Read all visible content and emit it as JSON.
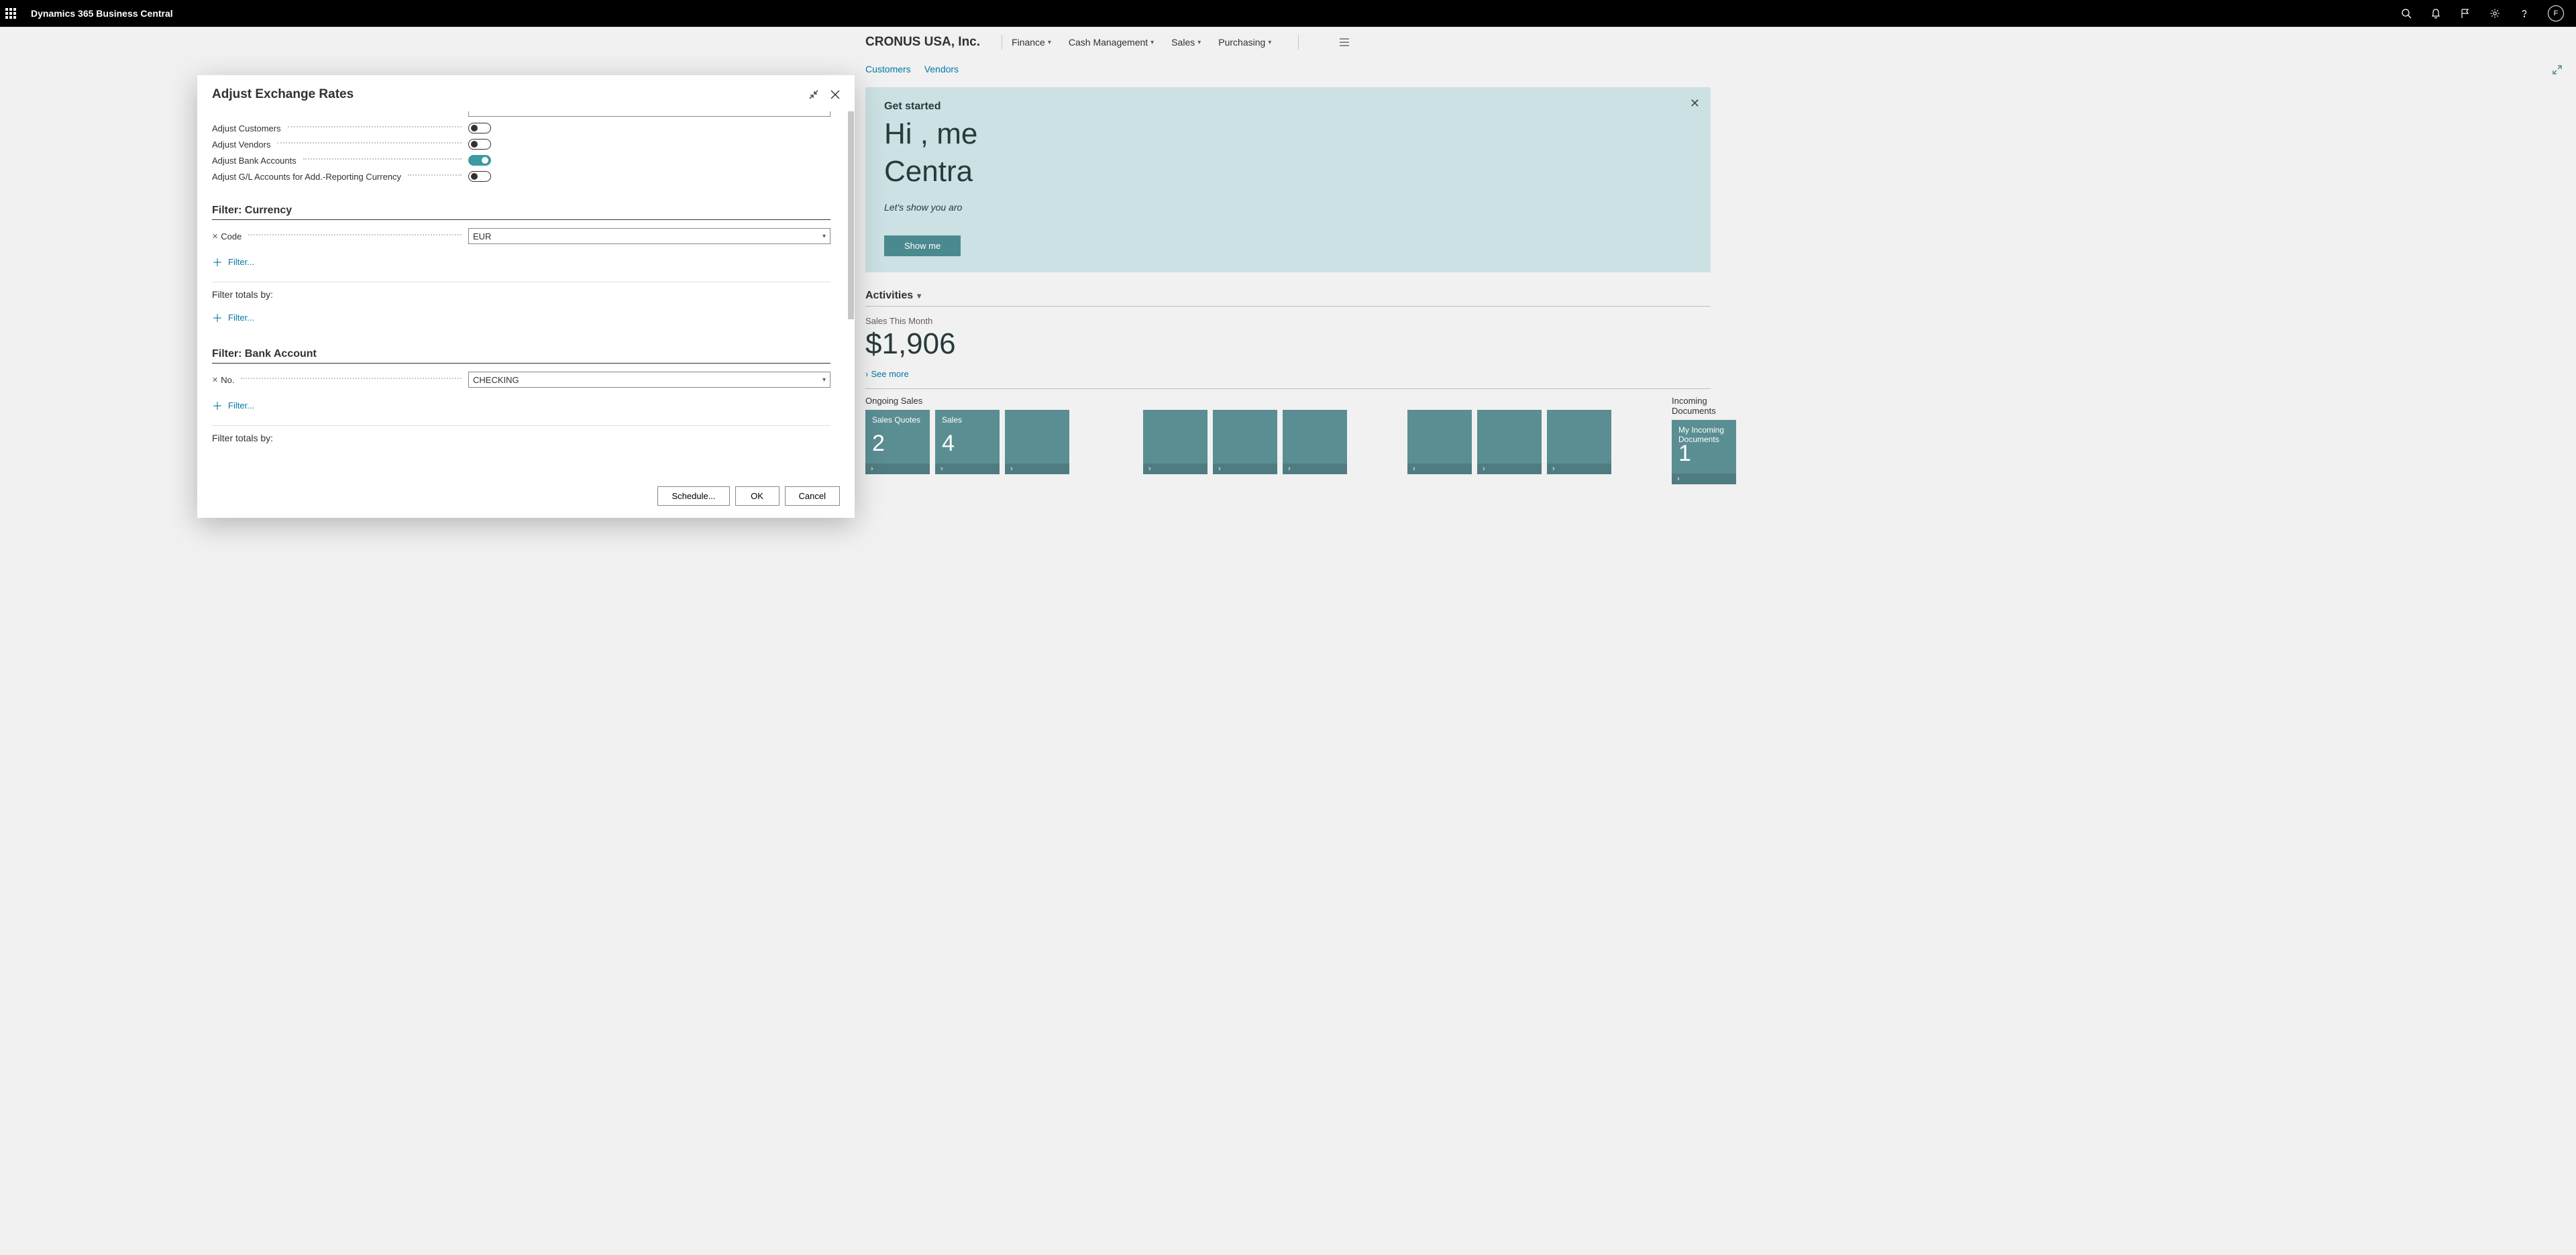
{
  "topbar": {
    "app_title": "Dynamics 365 Business Central",
    "avatar_initial": "F"
  },
  "page": {
    "company": "CRONUS USA, Inc.",
    "nav": {
      "finance": "Finance",
      "cash": "Cash Management",
      "sales": "Sales",
      "purchasing": "Purchasing"
    },
    "secnav": {
      "customers": "Customers",
      "vendors": "Vendors"
    }
  },
  "hero": {
    "started": "Get started",
    "line1": "Hi , me",
    "line2": "Centra",
    "sub": "Let's show you aro",
    "button": "Show me"
  },
  "activities": {
    "title": "Activities",
    "metric_label": "Sales This Month",
    "metric_value": "$1,906",
    "see_more": "See more"
  },
  "sections": {
    "ongoing_sales": {
      "title": "Ongoing Sales",
      "tiles": [
        {
          "title": "Sales Quotes",
          "num": "2"
        },
        {
          "title": "Sales",
          "num": "4"
        }
      ]
    },
    "incoming_docs": {
      "title": "Incoming Documents",
      "tiles": [
        {
          "title": "My Incoming Documents",
          "num": "1"
        }
      ]
    }
  },
  "modal": {
    "title": "Adjust Exchange Rates",
    "toggles": {
      "adjust_customers": "Adjust Customers",
      "adjust_vendors": "Adjust Vendors",
      "adjust_bank": "Adjust Bank Accounts",
      "adjust_gl": "Adjust G/L Accounts for Add.-Reporting Currency"
    },
    "sec_currency": {
      "title": "Filter: Currency",
      "code_label": "Code",
      "code_value": "EUR",
      "addfilter": "Filter...",
      "totals": "Filter totals by:"
    },
    "sec_bank": {
      "title": "Filter: Bank Account",
      "no_label": "No.",
      "no_value": "CHECKING",
      "addfilter": "Filter...",
      "totals": "Filter totals by:"
    },
    "footer": {
      "schedule": "Schedule...",
      "ok": "OK",
      "cancel": "Cancel"
    }
  }
}
